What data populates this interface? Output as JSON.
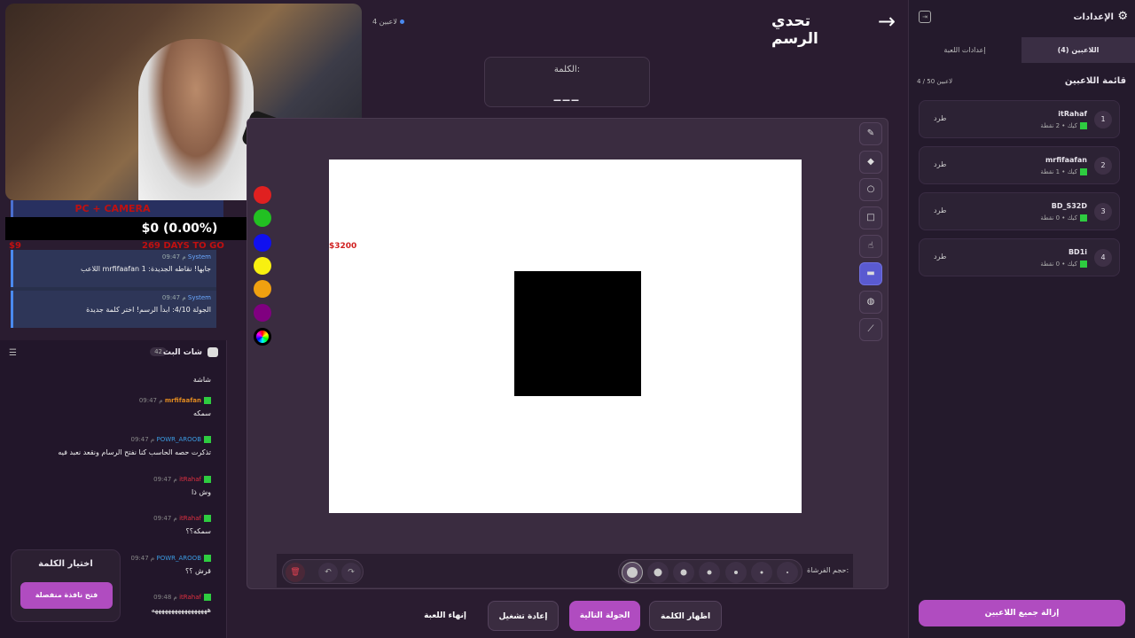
{
  "overlay": {
    "ticker_text": "PC + CAMERA",
    "balance": "$0 (0.00%)",
    "sub_left": "$9",
    "sub_right": "269 DAYS TO GO",
    "system_messages": [
      {
        "sender": "System",
        "time": "09:47 م",
        "text": "اللاعب mrfifaafan جابها! نقاطه الجديدة: 1"
      },
      {
        "sender": "System",
        "time": "09:47 م",
        "text": "الجولة 4/10: ابدأ الرسم! اختر كلمة جديدة"
      }
    ]
  },
  "live_chat": {
    "title": "شات البث",
    "count": "42",
    "messages": [
      {
        "user": "",
        "time": "",
        "text": "شاشة"
      },
      {
        "user": "mrfifaafan",
        "time": "09:47 م",
        "text": "سمكه",
        "color": "orange"
      },
      {
        "user": "POWR_AROOB",
        "time": "09:47 م",
        "text": "تذكرت حصه الحاسب كنا نفتح الرسام ونقعد نعبد فيه",
        "color": "blue"
      },
      {
        "user": "itRahaf",
        "time": "09:47 م",
        "text": "وش ذا",
        "color": "red"
      },
      {
        "user": "itRahaf",
        "time": "09:47 م",
        "text": "سمكه؟؟",
        "color": "red"
      },
      {
        "user": "POWR_AROOB",
        "time": "09:47 م",
        "text": "قرش ؟؟",
        "color": "blue"
      },
      {
        "user": "itRahaf",
        "time": "09:48 م",
        "text": "هههههههههههههههههه",
        "color": "red"
      }
    ]
  },
  "word_choice": {
    "title": "اختيار الكلمة",
    "button": "فتح نافذة منفصلة"
  },
  "header": {
    "players": "4 لاعبين",
    "title": "تحدي الرسم",
    "back_icon": "arrow-right-icon"
  },
  "word_card": {
    "label": "الكلمة:",
    "blanks": "___"
  },
  "canvas": {
    "price_label": "$3200"
  },
  "colors": [
    "#e02020",
    "#22c022",
    "#1010f0",
    "#f8f010",
    "#f0a010",
    "#800080",
    "#000000"
  ],
  "tools": [
    "pencil-icon",
    "eraser-icon",
    "circle-icon",
    "square-icon",
    "hand-icon",
    "filled-rect-icon",
    "fill-icon",
    "line-icon"
  ],
  "brush": {
    "label": "حجم الفرشاة:",
    "sizes": [
      12,
      9,
      7,
      5,
      4,
      3,
      2
    ],
    "selected": 0
  },
  "actions": {
    "reveal": "اظهار الكلمة",
    "next": "الجولة التالية",
    "restart": "إعادة تشغيل",
    "end": "إنهاء اللعبة"
  },
  "settings": {
    "title": "الإعدادات",
    "tab_players": "اللاعبين (4)",
    "tab_game": "إعدادات اللعبة",
    "list_title": "قائمة اللاعبين",
    "list_count": "4 / 50 لاعبين",
    "kick_label": "طرد",
    "players": [
      {
        "rank": "1",
        "name": "itRahaf",
        "points": "كيك • 2 نقطة"
      },
      {
        "rank": "2",
        "name": "mrfifaafan",
        "points": "كيك • 1 نقطة"
      },
      {
        "rank": "3",
        "name": "BD_S32D",
        "points": "كيك • 0 نقطة"
      },
      {
        "rank": "4",
        "name": "BD1i",
        "points": "كيك • 0 نقطة"
      }
    ],
    "remove_all": "إزالة جميع اللاعبين"
  }
}
